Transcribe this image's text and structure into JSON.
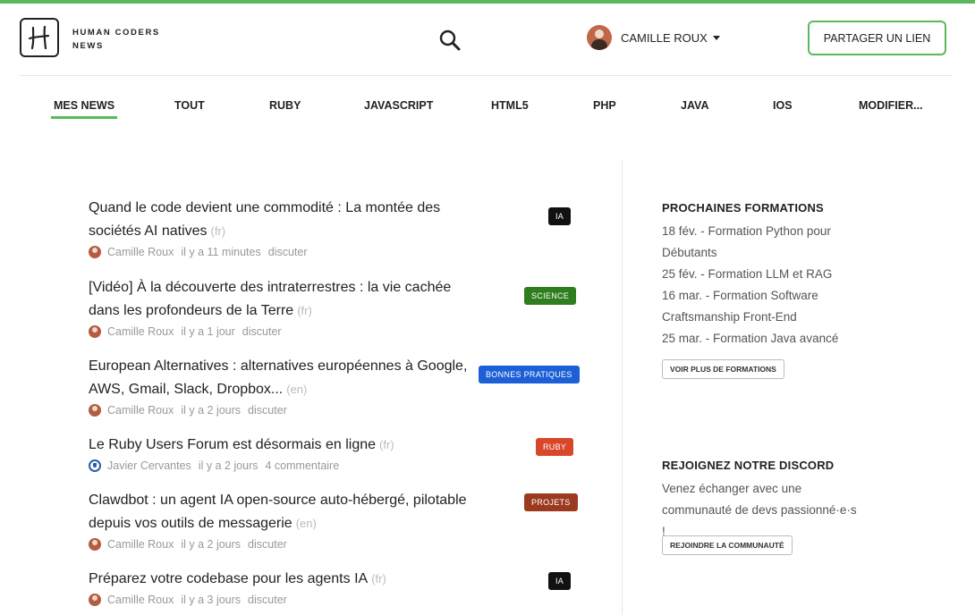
{
  "header": {
    "logo_line1": "HUMAN CODERS",
    "logo_line2": "NEWS",
    "search_icon": "magnifier",
    "user_name": "CAMILLE ROUX",
    "share_label": "PARTAGER UN LIEN"
  },
  "nav": {
    "items": [
      {
        "label": "MES NEWS"
      },
      {
        "label": "TOUT"
      },
      {
        "label": "RUBY"
      },
      {
        "label": "JAVASCRIPT"
      },
      {
        "label": "HTML5"
      },
      {
        "label": "PHP"
      },
      {
        "label": "JAVA"
      },
      {
        "label": "IOS"
      },
      {
        "label": "MODIFIER..."
      }
    ],
    "active": "MES NEWS"
  },
  "news": [
    {
      "title": "Quand le code devient une commodité : La montée des sociétés AI natives",
      "lang": "(fr)",
      "author": "Camille Roux",
      "time": "il y a 11 minutes",
      "action": "discuter",
      "tag": "IA",
      "tag_color": "#111111"
    },
    {
      "title": "[Vidéo] À la découverte des intraterrestres : la vie cachée dans les profondeurs de la Terre",
      "lang": "(fr)",
      "author": "Camille Roux",
      "time": "il y a 1 jour",
      "action": "discuter",
      "tag": "SCIENCE",
      "tag_color": "#2e7d1e"
    },
    {
      "title": "European Alternatives : alternatives européennes à Google, AWS, Gmail, Slack, Dropbox...",
      "lang": "(en)",
      "author": "Camille Roux",
      "time": "il y a 2 jours",
      "action": "discuter",
      "tag": "BONNES PRATIQUES",
      "tag_color": "#1c5fd6"
    },
    {
      "title": "Le Ruby Users Forum est désormais en ligne",
      "lang": "(fr)",
      "author": "Javier Cervantes",
      "time": "il y a 2 jours",
      "action": "4 commentaire",
      "tag": "RUBY",
      "tag_color": "#d9472b"
    },
    {
      "title": "Clawdbot : un agent IA open-source auto-hébergé, pilotable depuis vos outils de messagerie",
      "lang": "(en)",
      "author": "Camille Roux",
      "time": "il y a 2 jours",
      "action": "discuter",
      "tag": "PROJETS",
      "tag_color": "#9c3a1f"
    },
    {
      "title": "Préparez votre codebase pour les agents IA",
      "lang": "(fr)",
      "author": "Camille Roux",
      "time": "il y a 3 jours",
      "action": "discuter",
      "tag": "IA",
      "tag_color": "#111111"
    }
  ],
  "sidebar": {
    "trainings_title": "PROCHAINES FORMATIONS",
    "trainings": [
      "18 fév. - Formation Python pour Débutants",
      "25 fév. - Formation LLM et RAG",
      "16 mar. - Formation Software Craftsmanship Front-End",
      "25 mar. - Formation Java avancé"
    ],
    "trainings_button": "VOIR PLUS DE FORMATIONS",
    "discord_title": "REJOIGNEZ NOTRE DISCORD",
    "discord_text": "Venez échanger avec une communauté de devs passionné·e·s !",
    "discord_button": "REJOINDRE LA COMMUNAUTÉ"
  },
  "colors": {
    "accent": "#5cb85c"
  }
}
